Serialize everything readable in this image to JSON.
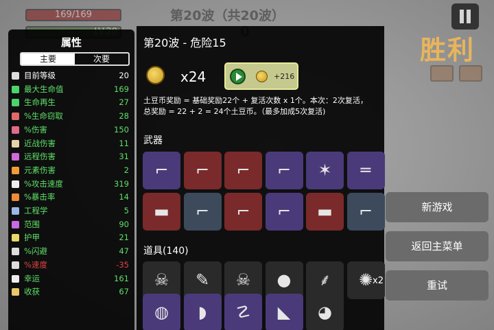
{
  "hud": {
    "hp": "169/169",
    "level": "LV.20",
    "wave_banner": "第20波（共20波）",
    "wave_count": "0",
    "victory": "胜利"
  },
  "stats_panel": {
    "title": "属性",
    "tab_main": "主要",
    "tab_secondary": "次要",
    "rows": [
      {
        "icon": "level-icon",
        "label": "目前等级",
        "value": "20",
        "color": "#ffffff",
        "icon_color": "#dddddd"
      },
      {
        "icon": "heart-icon",
        "label": "最大生命值",
        "value": "169",
        "color": "#5ee06a",
        "icon_color": "#4bd46a"
      },
      {
        "icon": "regen-icon",
        "label": "生命再生",
        "value": "27",
        "color": "#5ee06a",
        "icon_color": "#4bd46a"
      },
      {
        "icon": "lifesteal-icon",
        "label": "%生命窃取",
        "value": "28",
        "color": "#5ee06a",
        "icon_color": "#e06a6a"
      },
      {
        "icon": "damage-icon",
        "label": "%伤害",
        "value": "150",
        "color": "#5ee06a",
        "icon_color": "#e26a8a"
      },
      {
        "icon": "melee-icon",
        "label": "近战伤害",
        "value": "11",
        "color": "#5ee06a",
        "icon_color": "#e8d3a8"
      },
      {
        "icon": "ranged-icon",
        "label": "远程伤害",
        "value": "31",
        "color": "#5ee06a",
        "icon_color": "#cf6ad8"
      },
      {
        "icon": "elemental-icon",
        "label": "元素伤害",
        "value": "2",
        "color": "#5ee06a",
        "icon_color": "#f09a3a"
      },
      {
        "icon": "attack-speed-icon",
        "label": "%攻击速度",
        "value": "319",
        "color": "#5ee06a",
        "icon_color": "#eeeeee"
      },
      {
        "icon": "crit-icon",
        "label": "%暴击率",
        "value": "14",
        "color": "#5ee06a",
        "icon_color": "#f08a3a"
      },
      {
        "icon": "engineering-icon",
        "label": "工程学",
        "value": "5",
        "color": "#5ee06a",
        "icon_color": "#9ab8e8"
      },
      {
        "icon": "range-icon",
        "label": "范围",
        "value": "90",
        "color": "#5ee06a",
        "icon_color": "#c86ae8"
      },
      {
        "icon": "armor-icon",
        "label": "护甲",
        "value": "21",
        "color": "#5ee06a",
        "icon_color": "#e8d86a"
      },
      {
        "icon": "dodge-icon",
        "label": "%闪避",
        "value": "47",
        "color": "#5ee06a",
        "icon_color": "#dddddd"
      },
      {
        "icon": "speed-icon",
        "label": "%速度",
        "value": "-35",
        "color": "#e04444",
        "icon_color": "#dddddd"
      },
      {
        "icon": "luck-icon",
        "label": "幸运",
        "value": "161",
        "color": "#5ee06a",
        "icon_color": "#eeeeee"
      },
      {
        "icon": "harvest-icon",
        "label": "收获",
        "value": "67",
        "color": "#5ee06a",
        "icon_color": "#e8c86a"
      }
    ]
  },
  "main_panel": {
    "title": "第20波 - 危险15",
    "coin_count": "x24",
    "reward_amount": "+216",
    "desc_line1": "土豆币奖励 = 基础奖励22个 + 复活次数 x 1个。本次：2次复活，",
    "desc_line2": "总奖励 = 22 + 2 = 24个土豆币。（最多加成5次复活)",
    "weapons_label": "武器",
    "items_label": "道具(140)",
    "item_qty": "x2"
  },
  "weapons": [
    {
      "name": "pistol-weapon-icon",
      "tier": "t2",
      "glyph": "⌐"
    },
    {
      "name": "revolver-weapon-icon",
      "tier": "t3",
      "glyph": "⌐"
    },
    {
      "name": "taser-weapon-icon",
      "tier": "t3",
      "glyph": "⌐"
    },
    {
      "name": "pistol-weapon-icon",
      "tier": "t2",
      "glyph": "⌐"
    },
    {
      "name": "crossbow-weapon-icon",
      "tier": "t2",
      "glyph": "✶"
    },
    {
      "name": "shotgun-weapon-icon",
      "tier": "t2",
      "glyph": "═"
    },
    {
      "name": "rocket-launcher-weapon-icon",
      "tier": "t3",
      "glyph": "▬"
    },
    {
      "name": "smg-weapon-icon",
      "tier": "t1",
      "glyph": "⌐"
    },
    {
      "name": "laser-gun-weapon-icon",
      "tier": "t3",
      "glyph": "⌐"
    },
    {
      "name": "lightning-gun-weapon-icon",
      "tier": "t2",
      "glyph": "⌐"
    },
    {
      "name": "rocket-launcher-weapon-icon",
      "tier": "t3",
      "glyph": "▬"
    },
    {
      "name": "laser-gun-weapon-icon",
      "tier": "t1",
      "glyph": "⌐"
    }
  ],
  "items": [
    {
      "name": "skull-item-icon",
      "tier": "t0",
      "glyph": "☠"
    },
    {
      "name": "syringe-item-icon",
      "tier": "t0",
      "glyph": "✎"
    },
    {
      "name": "skull-helmet-item-icon",
      "tier": "t0",
      "glyph": "☠"
    },
    {
      "name": "eggs-item-icon",
      "tier": "t0",
      "glyph": "●"
    },
    {
      "name": "wheat-item-icon",
      "tier": "t0",
      "glyph": "⸙"
    },
    {
      "name": "feather-item-icon",
      "tier": "t0",
      "glyph": "✺"
    },
    {
      "name": "honey-jar-item-icon",
      "tier": "t2",
      "glyph": "◍"
    },
    {
      "name": "glove-item-icon",
      "tier": "t2",
      "glyph": "◗"
    },
    {
      "name": "tentacle-item-icon",
      "tier": "t2",
      "glyph": "☡"
    },
    {
      "name": "fin-item-icon",
      "tier": "t2",
      "glyph": "◣"
    },
    {
      "name": "potato-item-icon",
      "tier": "t0",
      "glyph": "◕"
    }
  ],
  "buttons": {
    "new_game": "新游戏",
    "main_menu": "返回主菜单",
    "retry": "重试"
  }
}
